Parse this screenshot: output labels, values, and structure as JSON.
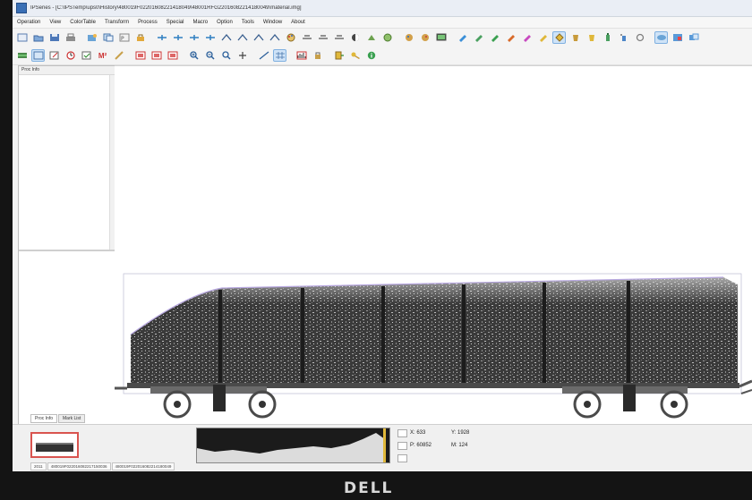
{
  "window": {
    "title": "IPSeries - [C:\\IPSTemp\\ups0\\History\\480019F02201608221418049\\48001RFG22016082214180049\\material.img]"
  },
  "menu": {
    "items": [
      "Operation",
      "View",
      "ColorTable",
      "Transform",
      "Process",
      "Special",
      "Macro",
      "Option",
      "Tools",
      "Window",
      "About"
    ]
  },
  "toolbar": {
    "m2_label": "M²"
  },
  "left_panel": {
    "title": "Proc Info",
    "tabs": [
      "Proc Info",
      "Mark List"
    ]
  },
  "readout": {
    "x_label": "X: 633",
    "y_label": "Y: 1928",
    "p_label": "P: 60852",
    "m_label": "M: 124"
  },
  "status": {
    "tabs": [
      "2011",
      "480019F022016082217150036",
      "480019F022016082214180049"
    ]
  },
  "brand": {
    "logo_text": "DELL"
  },
  "colors": {
    "selected_button_bg": "#cfe3f7",
    "thumbnail_border": "#d9544f",
    "cargo_dark": "#2b2b2b"
  }
}
